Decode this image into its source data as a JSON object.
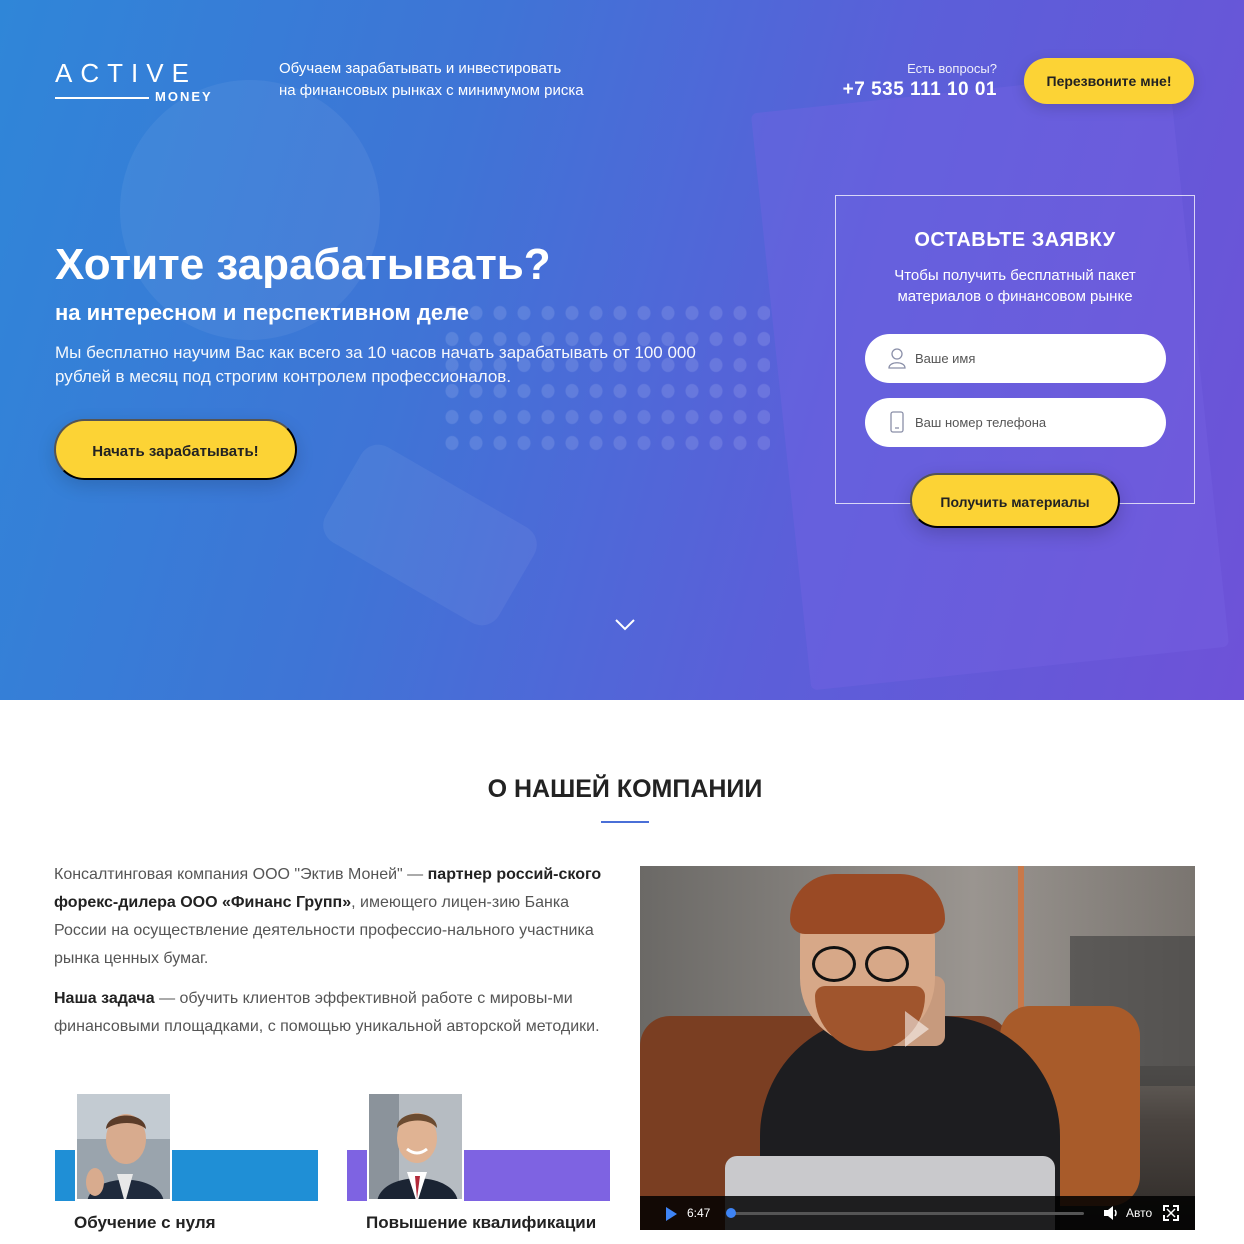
{
  "brand": {
    "logo_text": "ACTIVE",
    "logo_sub": "MONEY"
  },
  "header": {
    "tagline_line1": "Обучаем зарабатывать и инвестировать",
    "tagline_line2": "на финансовых рынках с минимумом риска",
    "question": "Есть вопросы?",
    "phone": "+7 535 111 10 01",
    "callback_label": "Перезвоните мне!"
  },
  "hero": {
    "title": "Хотите зарабатывать?",
    "subtitle": "на интересном и перспективном деле",
    "description": "Мы бесплатно научим Вас как всего за 10 часов начать зарабатывать от 100 000 рублей в месяц под строгим контролем профессионалов.",
    "cta_label": "Начать зарабатывать!"
  },
  "form": {
    "title": "ОСТАВЬТЕ ЗАЯВКУ",
    "subtitle_line1": "Чтобы получить бесплатный пакет",
    "subtitle_line2": "материалов о финансовом рынке",
    "name_placeholder": "Ваше имя",
    "phone_placeholder": "Ваш номер телефона",
    "submit_label": "Получить материалы"
  },
  "about": {
    "title": "О НАШЕЙ КОМПАНИИ",
    "p1_a": "Консалтинговая компания ООО \"Эктив Моней\" — ",
    "p1_b": "партнер россий-ского форекс-дилера ООО «Финанс Групп»",
    "p1_c": ", имеющего лицен-зию Банка России на осуществление деятельности профессио-нального участника рынка ценных бумаг.",
    "p2_a": "Наша задача",
    "p2_b": " — обучить клиентов эффективной работе с мировы-ми финансовыми площадками, с помощью уникальной авторской методики.",
    "cards": [
      {
        "label": "Обучение с нуля",
        "color": "#1f8fd6"
      },
      {
        "label": "Повышение квалификации",
        "color": "#7e63e2"
      }
    ]
  },
  "video": {
    "time": "6:47",
    "progress": 0.0,
    "quality": "Авто"
  },
  "colors": {
    "accent_yellow": "#fcd335",
    "hero_left": "#2f86d8",
    "hero_right": "#6e52d8",
    "blue_band": "#1f8fd6",
    "purple_band": "#7e63e2"
  }
}
